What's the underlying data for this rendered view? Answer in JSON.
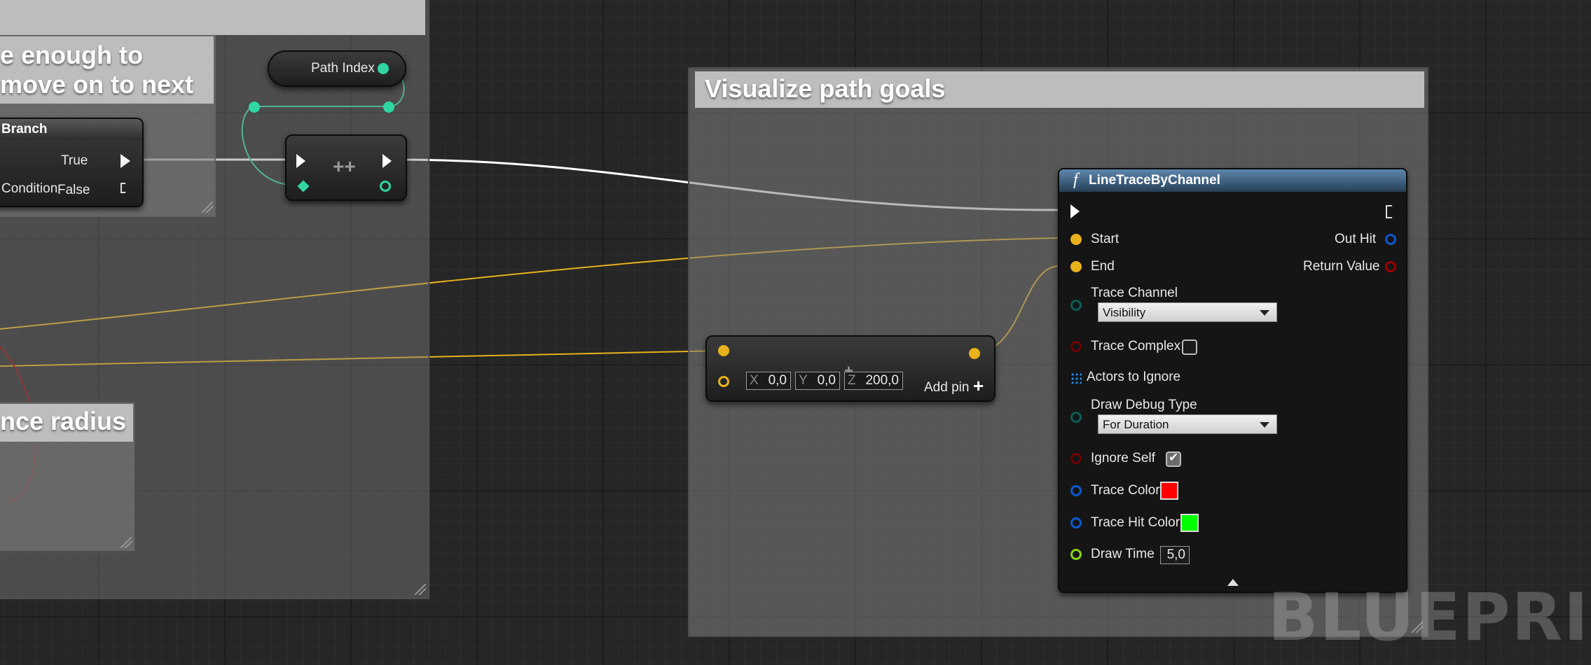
{
  "comments": {
    "left_top_line1": "e enough to",
    "left_top_line2": "move on to next",
    "left_bottom": "nce radius",
    "main": "Visualize path goals"
  },
  "branch_node": {
    "title": "Branch",
    "condition_label": "Condition",
    "true_label": "True",
    "false_label": "False"
  },
  "path_index_node": {
    "label": "Path Index"
  },
  "increment_node": {
    "symbol": "++"
  },
  "make_vector_node": {
    "x_axis": "X",
    "x_value": "0,0",
    "y_axis": "Y",
    "y_value": "0,0",
    "z_axis": "Z",
    "z_value": "200,0",
    "add_pin_label": "Add pin",
    "add_pin_icon": "plus-icon"
  },
  "line_trace_node": {
    "function_icon": "f",
    "title": "LineTraceByChannel",
    "start_label": "Start",
    "end_label": "End",
    "out_hit_label": "Out Hit",
    "return_value_label": "Return Value",
    "trace_channel_label": "Trace Channel",
    "trace_channel_value": "Visibility",
    "trace_complex_label": "Trace Complex",
    "trace_complex_checked": false,
    "actors_to_ignore_label": "Actors to Ignore",
    "draw_debug_type_label": "Draw Debug Type",
    "draw_debug_type_value": "For Duration",
    "ignore_self_label": "Ignore Self",
    "ignore_self_checked": true,
    "trace_color_label": "Trace Color",
    "trace_color": "#ff0000",
    "trace_hit_color_label": "Trace Hit Color",
    "trace_hit_color": "#00ff00",
    "draw_time_label": "Draw Time",
    "draw_time_value": "5,0"
  },
  "colors": {
    "exec_wire": "#ffffff",
    "vector_wire": "#e8b21c",
    "int_wire": "#2fd6a1",
    "bool_wire": "#a00000",
    "struct_pin": "#0a5ad0",
    "header_blue": "#2c4e6e"
  },
  "watermark": "BLUEPRINT"
}
